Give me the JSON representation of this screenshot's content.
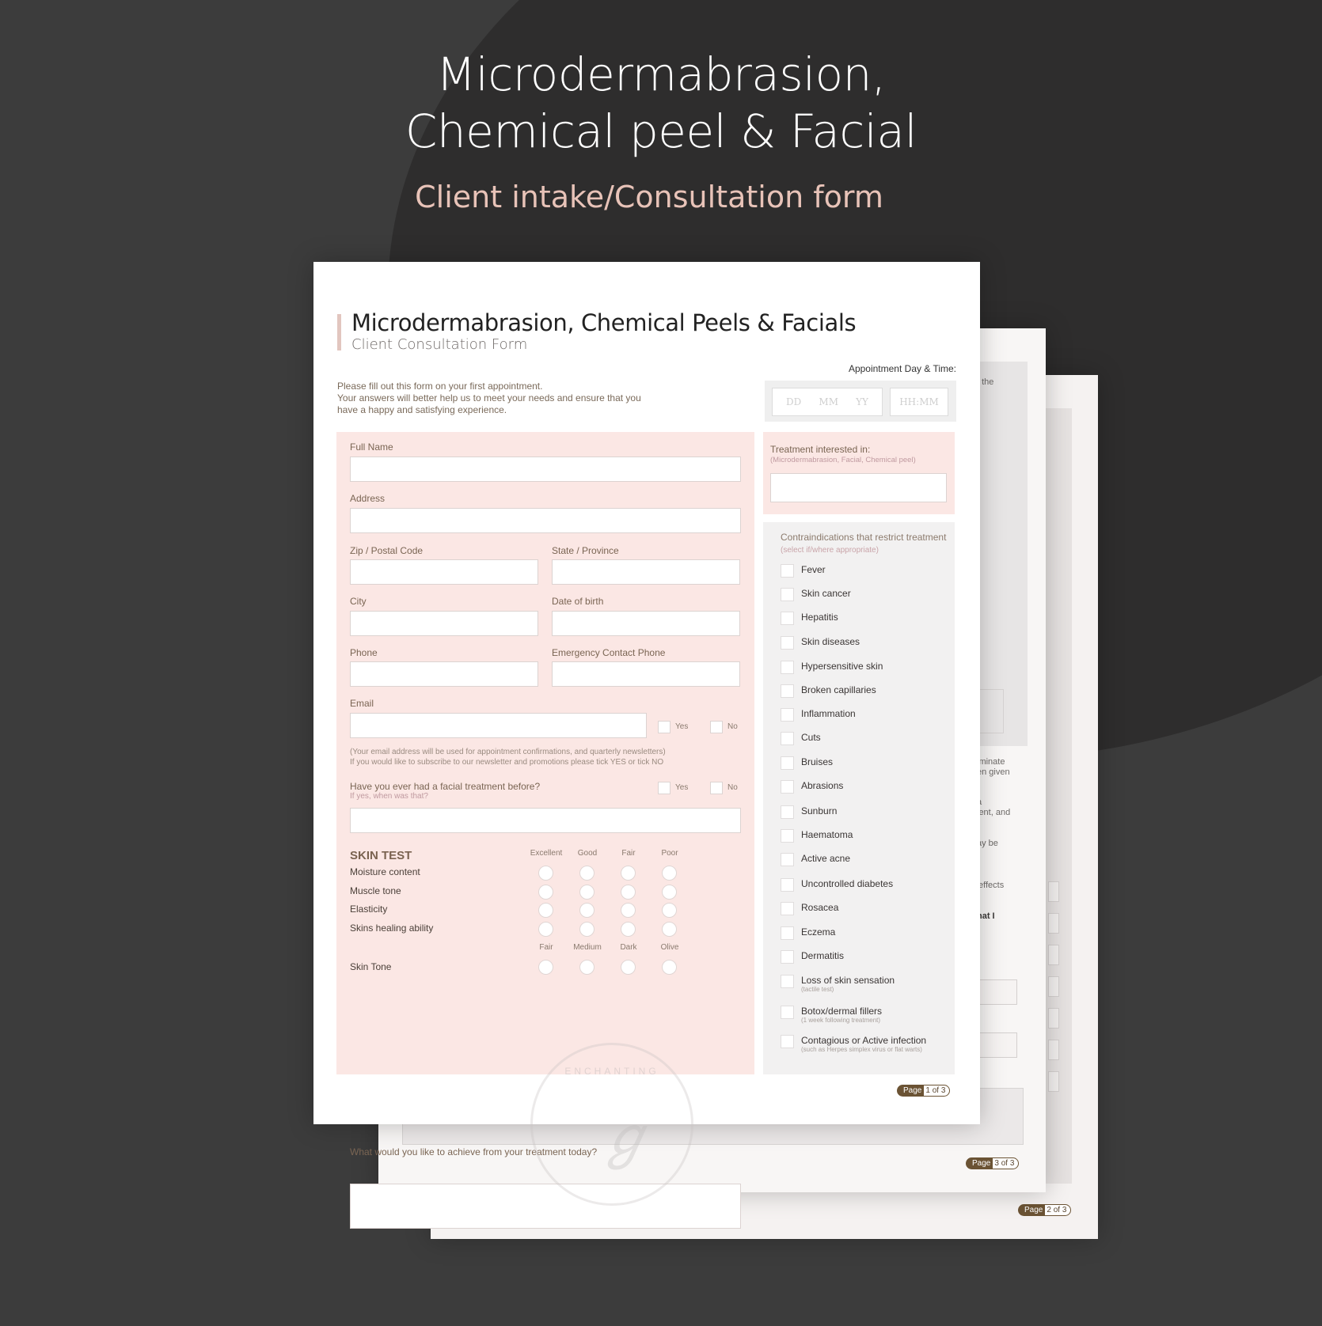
{
  "hero": {
    "title_line1": "Microdermabrasion,",
    "title_line2": "Chemical peel & Facial",
    "subtitle": "Client intake/Consultation form"
  },
  "colors": {
    "background": "#3c3c3c",
    "accent_pink": "#fbe7e4",
    "subtitle_pink": "#e8c3b8",
    "badge_brown": "#6b5334"
  },
  "page_badges": [
    {
      "label": "Page",
      "current": "1",
      "of": "of",
      "total": "3"
    },
    {
      "label": "Page",
      "current": "3",
      "of": "of",
      "total": "3"
    },
    {
      "label": "Page",
      "current": "2",
      "of": "of",
      "total": "3"
    }
  ],
  "background_page_fragments": [
    "f the",
    "iminate",
    "en given",
    "a",
    "ient, and",
    "ay be",
    "effects",
    "hat I"
  ],
  "form": {
    "title": "Microdermabrasion, Chemical Peels & Facials",
    "subtitle": "Client Consultation Form",
    "intro_line1": "Please fill out this form on your first appointment.",
    "intro_line2": "Your answers will better help us to meet your needs and ensure that you",
    "intro_line3": "have a happy and satisfying experience.",
    "appointment": {
      "label": "Appointment Day & Time:",
      "dd_placeholder": "DD",
      "mm_placeholder": "MM",
      "yy_placeholder": "YY",
      "time_placeholder": "HH:MM"
    },
    "fields": {
      "full_name": {
        "label": "Full Name",
        "value": ""
      },
      "address": {
        "label": "Address",
        "value": ""
      },
      "zip": {
        "label": "Zip / Postal Code",
        "value": ""
      },
      "state": {
        "label": "State / Province",
        "value": ""
      },
      "city": {
        "label": "City",
        "value": ""
      },
      "dob": {
        "label": "Date of birth",
        "value": ""
      },
      "phone": {
        "label": "Phone",
        "value": ""
      },
      "emergency_phone": {
        "label": "Emergency Contact Phone",
        "value": ""
      },
      "email": {
        "label": "Email",
        "value": ""
      }
    },
    "email_opt": {
      "yes": "Yes",
      "no": "No"
    },
    "email_note_line1": "(Your email address will be used for appointment confirmations, and quarterly newsletters)",
    "email_note_line2": "If you would like to subscribe to our newsletter and promotions please tick YES or tick NO",
    "facial_before": {
      "question": "Have you ever had a facial treatment before?",
      "hint": "If yes, when was that?",
      "yes": "Yes",
      "no": "No",
      "value": ""
    },
    "skin_test": {
      "title": "SKIN TEST",
      "columns": [
        "Excellent",
        "Good",
        "Fair",
        "Poor"
      ],
      "rows": [
        "Moisture content",
        "Muscle tone",
        "Elasticity",
        "Skins healing ability"
      ],
      "tone_columns": [
        "Fair",
        "Medium",
        "Dark",
        "Olive"
      ],
      "tone_label": "Skin Tone"
    },
    "goal": {
      "question": "What would you like to achieve from your treatment today?",
      "value": ""
    },
    "treatment": {
      "label": "Treatment interested in:",
      "hint": "(Microdermabrasion, Facial, Chemical peel)",
      "value": ""
    },
    "contraindications": {
      "title": "Contraindications that restrict treatment",
      "hint": "(select if/where appropriate)",
      "items": [
        {
          "label": "Fever",
          "sub": ""
        },
        {
          "label": "Skin cancer",
          "sub": ""
        },
        {
          "label": "Hepatitis",
          "sub": ""
        },
        {
          "label": "Skin diseases",
          "sub": ""
        },
        {
          "label": "Hypersensitive skin",
          "sub": ""
        },
        {
          "label": "Broken capillaries",
          "sub": ""
        },
        {
          "label": "Inflammation",
          "sub": ""
        },
        {
          "label": "Cuts",
          "sub": ""
        },
        {
          "label": "Bruises",
          "sub": ""
        },
        {
          "label": "Abrasions",
          "sub": ""
        },
        {
          "label": "Sunburn",
          "sub": ""
        },
        {
          "label": "Haematoma",
          "sub": ""
        },
        {
          "label": "Active acne",
          "sub": ""
        },
        {
          "label": "Uncontrolled diabetes",
          "sub": ""
        },
        {
          "label": "Rosacea",
          "sub": ""
        },
        {
          "label": "Eczema",
          "sub": ""
        },
        {
          "label": "Dermatitis",
          "sub": ""
        },
        {
          "label": "Loss of skin sensation",
          "sub": "(tactile test)"
        },
        {
          "label": "Botox/dermal fillers",
          "sub": "(1 week following treatment)"
        },
        {
          "label": "Contagious or Active infection",
          "sub": "(such as Herpes simplex virus or flat warts)"
        }
      ]
    }
  },
  "watermark": {
    "text": "ENCHANTING",
    "monogram": "ℊ"
  }
}
